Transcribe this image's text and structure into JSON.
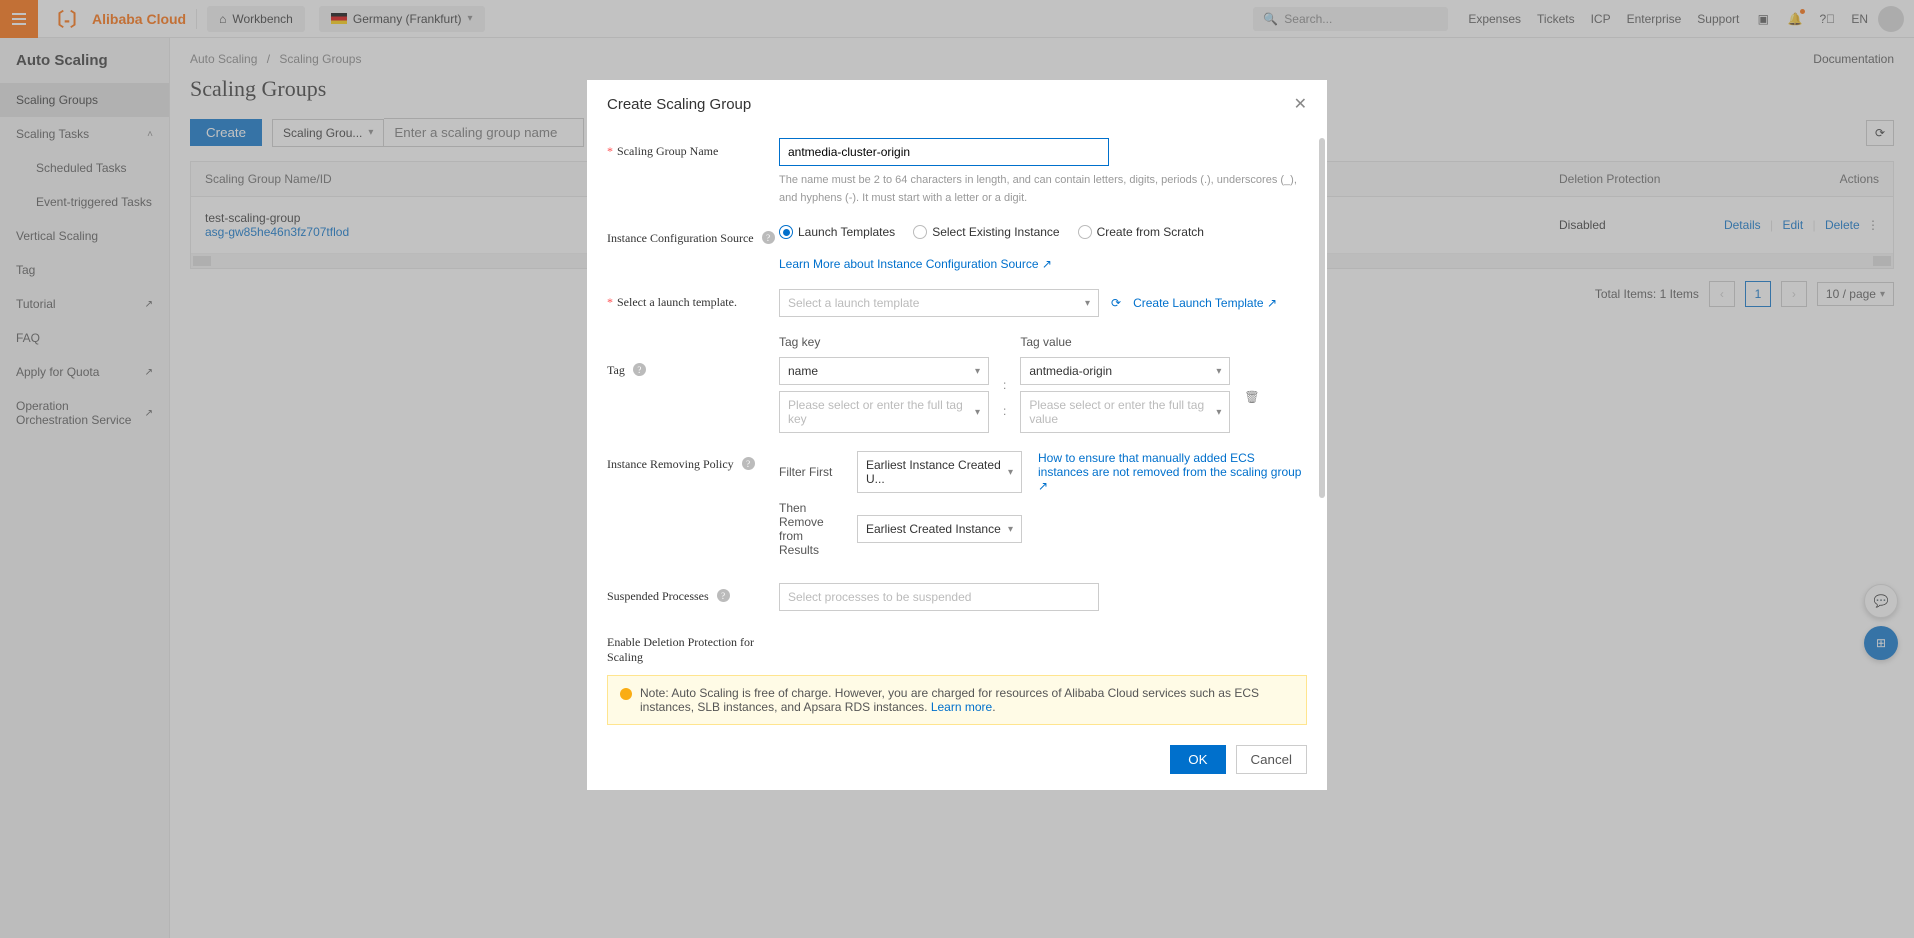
{
  "header": {
    "brand": "Alibaba Cloud",
    "workbench": "Workbench",
    "region": "Germany (Frankfurt)",
    "search_placeholder": "Search...",
    "links": {
      "expenses": "Expenses",
      "tickets": "Tickets",
      "icp": "ICP",
      "enterprise": "Enterprise",
      "support": "Support",
      "lang": "EN"
    }
  },
  "sidebar": {
    "title": "Auto Scaling",
    "items": {
      "scaling_groups": "Scaling Groups",
      "scaling_tasks": "Scaling Tasks",
      "scheduled": "Scheduled Tasks",
      "event_triggered": "Event-triggered Tasks",
      "vertical_scaling": "Vertical Scaling",
      "tag": "Tag",
      "tutorial": "Tutorial",
      "faq": "FAQ",
      "apply_quota": "Apply for Quota",
      "oos": "Operation Orchestration Service"
    }
  },
  "breadcrumb": {
    "parent": "Auto Scaling",
    "current": "Scaling Groups"
  },
  "page_title": "Scaling Groups",
  "doc_link": "Documentation",
  "toolbar": {
    "create": "Create",
    "filter": "Scaling Grou...",
    "search_placeholder": "Enter a scaling group name"
  },
  "table": {
    "cols": {
      "name": "Scaling Group Name/ID",
      "del": "Deletion Protection",
      "actions": "Actions"
    },
    "row": {
      "name": "test-scaling-group",
      "id": "asg-gw85he46n3fz707tflod",
      "del": "Disabled",
      "details": "Details",
      "edit": "Edit",
      "delete": "Delete"
    }
  },
  "pagination": {
    "total": "Total Items: 1 Items",
    "page": "1",
    "size": "10 / page"
  },
  "modal": {
    "title": "Create Scaling Group",
    "labels": {
      "name": "Scaling Group Name",
      "config_source": "Instance Configuration Source",
      "launch_template": "Select a launch template.",
      "tag": "Tag",
      "removing_policy": "Instance Removing Policy",
      "suspended": "Suspended Processes",
      "deletion_protection": "Enable Deletion Protection for Scaling"
    },
    "name_value": "antmedia-cluster-origin",
    "name_hint": "The name must be 2 to 64 characters in length, and can contain letters, digits, periods (.), underscores (_), and hyphens (-). It must start with a letter or a digit.",
    "radios": {
      "launch": "Launch Templates",
      "existing": "Select Existing Instance",
      "scratch": "Create from Scratch"
    },
    "learn_more": "Learn More about Instance Configuration Source",
    "launch_placeholder": "Select a launch template",
    "create_launch": "Create Launch Template",
    "tag_key_label": "Tag key",
    "tag_value_label": "Tag value",
    "tag_key": "name",
    "tag_value": "antmedia-origin",
    "tag_placeholder_key": "Please select or enter the full tag key",
    "tag_placeholder_value": "Please select or enter the full tag value",
    "filter_first": "Filter First",
    "filter_first_value": "Earliest Instance Created U...",
    "then_remove": "Then Remove from Results",
    "then_remove_value": "Earliest Created Instance",
    "removing_link": "How to ensure that manually added ECS instances are not removed from the scaling group",
    "suspended_placeholder": "Select processes to be suspended",
    "note": "Note: Auto Scaling is free of charge. However, you are charged for resources of Alibaba Cloud services such as ECS instances, SLB instances, and Apsara RDS instances. ",
    "note_link": "Learn more",
    "ok": "OK",
    "cancel": "Cancel"
  }
}
